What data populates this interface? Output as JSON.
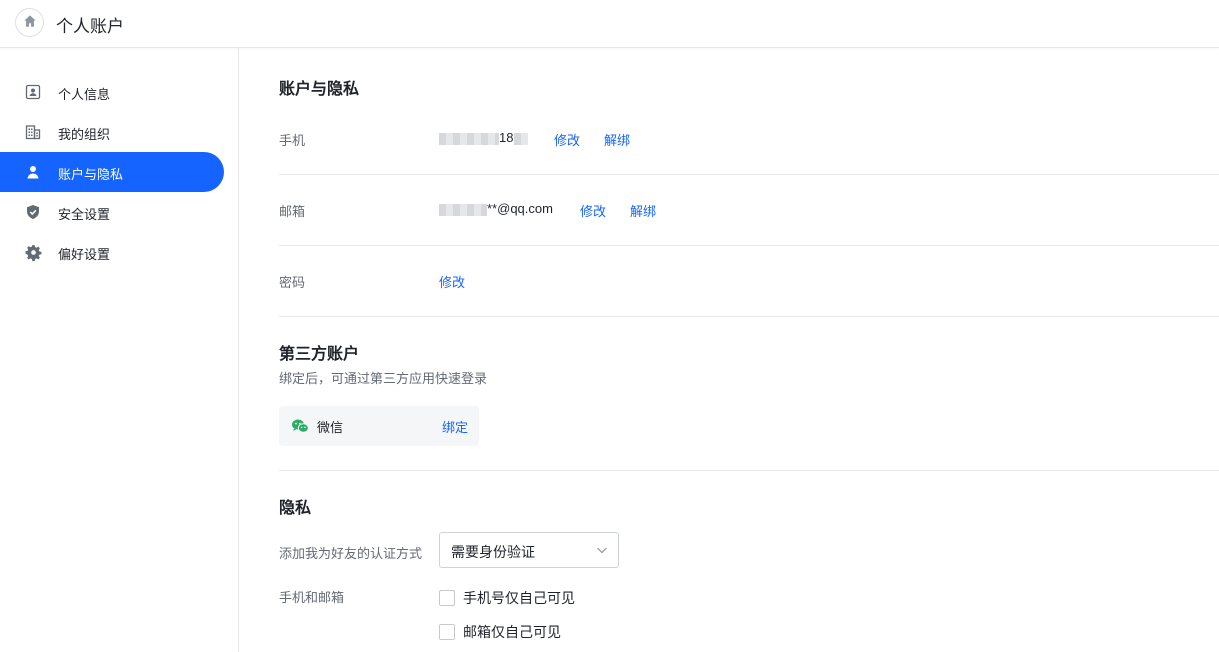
{
  "header": {
    "title": "个人账户",
    "home_icon": "home-icon"
  },
  "sidebar": {
    "items": [
      {
        "label": "个人信息",
        "icon": "id-card-icon"
      },
      {
        "label": "我的组织",
        "icon": "building-icon"
      },
      {
        "label": "账户与隐私",
        "icon": "user-icon",
        "active": true
      },
      {
        "label": "安全设置",
        "icon": "shield-icon"
      },
      {
        "label": "偏好设置",
        "icon": "gear-icon"
      }
    ]
  },
  "account": {
    "title": "账户与隐私",
    "phone": {
      "label": "手机",
      "value_suffix": "18",
      "edit": "修改",
      "unbind": "解绑"
    },
    "email": {
      "label": "邮箱",
      "value_suffix": "**@qq.com",
      "edit": "修改",
      "unbind": "解绑"
    },
    "password": {
      "label": "密码",
      "edit": "修改"
    }
  },
  "third_party": {
    "title": "第三方账户",
    "subtitle": "绑定后，可通过第三方应用快速登录",
    "wechat": {
      "label": "微信",
      "action": "绑定",
      "icon": "wechat-icon"
    }
  },
  "privacy": {
    "title": "隐私",
    "friend_method": {
      "label": "添加我为好友的认证方式",
      "selected": "需要身份验证"
    },
    "visibility": {
      "label": "手机和邮箱",
      "options": [
        {
          "label": "手机号仅自己可见",
          "checked": false
        },
        {
          "label": "邮箱仅自己可见",
          "checked": false
        }
      ]
    }
  },
  "colors": {
    "accent": "#1664ff",
    "wechat": "#2aae67"
  }
}
